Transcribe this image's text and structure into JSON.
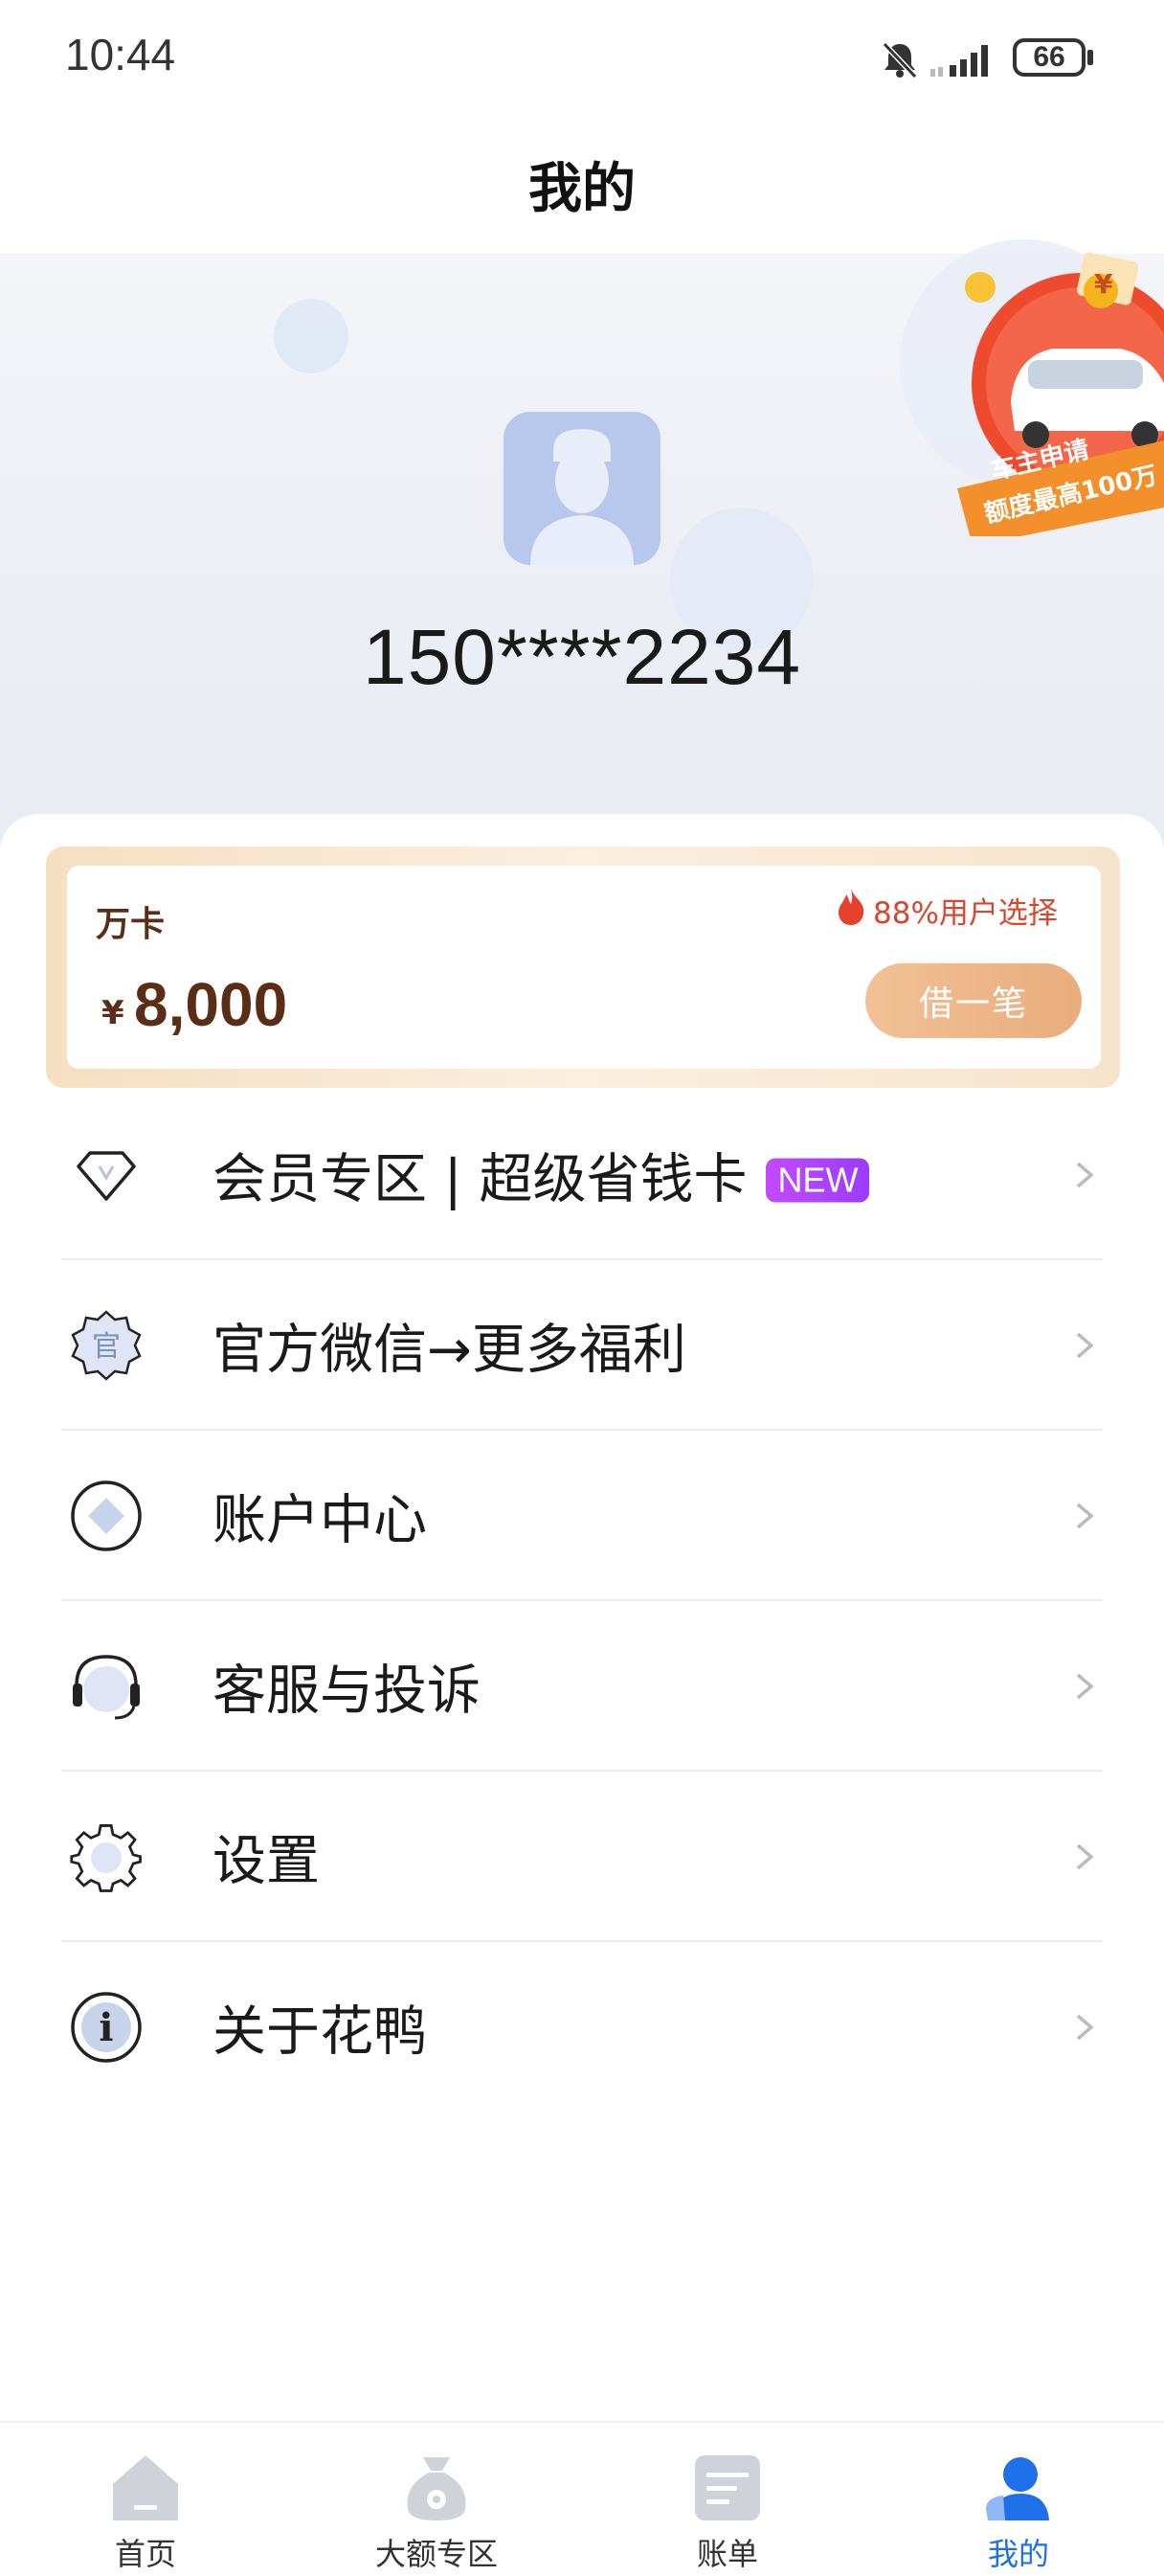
{
  "status_bar": {
    "time": "10:44",
    "battery": "66"
  },
  "header": {
    "title": "我的",
    "phone": "150****2234"
  },
  "promo": {
    "line1": "车主申请",
    "line2": "额度最高100万",
    "coin_symbol": "¥"
  },
  "loan_card": {
    "name": "万卡",
    "currency": "¥",
    "amount": "8,000",
    "users_pick": "88%用户选择",
    "button": "借一笔"
  },
  "menu": [
    {
      "label": "会员专区 | 超级省钱卡",
      "badge": "NEW",
      "icon": "diamond-icon"
    },
    {
      "label": "官方微信→更多福利",
      "icon": "official-seal-icon",
      "icon_text": "官"
    },
    {
      "label": "账户中心",
      "icon": "account-icon"
    },
    {
      "label": "客服与投诉",
      "icon": "headset-icon"
    },
    {
      "label": "设置",
      "icon": "gear-icon"
    },
    {
      "label": "关于花鸭",
      "icon": "info-icon",
      "icon_text": "i"
    }
  ],
  "bottom_nav": [
    {
      "label": "首页",
      "icon": "home-icon",
      "active": false
    },
    {
      "label": "大额专区",
      "icon": "money-bag-icon",
      "active": false
    },
    {
      "label": "账单",
      "icon": "bill-icon",
      "active": false
    },
    {
      "label": "我的",
      "icon": "profile-icon",
      "active": true
    }
  ],
  "colors": {
    "accent_active": "#1e6fe8",
    "loan_brown": "#5a2e16",
    "badge_purple": "#a63bff",
    "flame_red": "#e5412c"
  }
}
